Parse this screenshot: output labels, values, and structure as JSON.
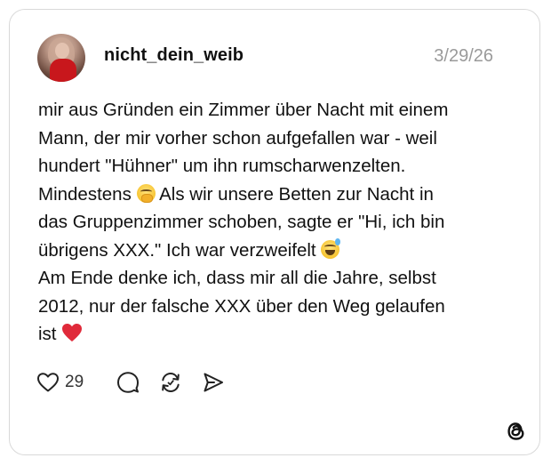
{
  "post": {
    "username": "nicht_dein_weib",
    "date": "3/29/26",
    "lines": {
      "l1": "mir aus Gründen ein Zimmer über Nacht mit einem",
      "l2": "Mann, der mir vorher schon aufgefallen war - weil",
      "l3": "hundert \"Hühner\" um ihn rumscharwenzelten.",
      "l4a": "Mindestens",
      "l4b": "Als wir unsere Betten zur Nacht in",
      "l5": "das Gruppenzimmer schoben, sagte er \"Hi, ich bin",
      "l6": "übrigens XXX.\" Ich war verzweifelt",
      "l7": "Am Ende denke ich, dass mir all die Jahre, selbst",
      "l8": "2012, nur der falsche XXX über den Weg gelaufen",
      "l9": "ist"
    },
    "emojis": {
      "face_hand": "face-with-hand-over-mouth",
      "sweat_smile": "grinning-face-with-sweat",
      "red_heart": "red-heart"
    }
  },
  "actions": {
    "like_count": "29",
    "icons": [
      "heart-icon",
      "comment-icon",
      "repost-icon",
      "share-icon"
    ]
  },
  "branding": {
    "logo": "threads-logo-icon"
  },
  "colors": {
    "text": "#111111",
    "muted": "#9a9a9a",
    "border": "#d9d9d9",
    "heart": "#e02a3a"
  }
}
